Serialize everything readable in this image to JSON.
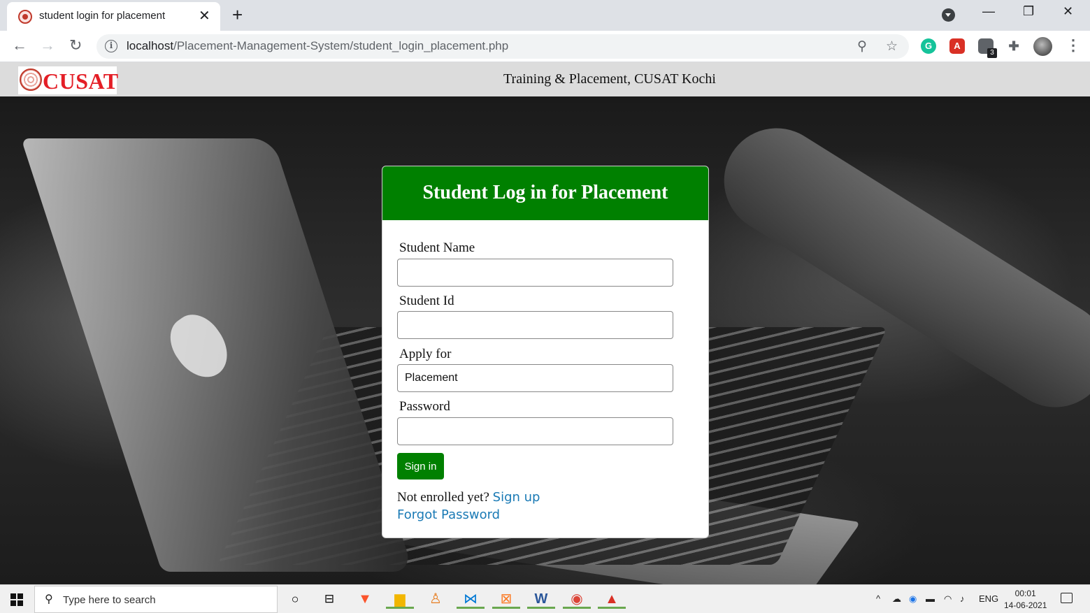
{
  "browser": {
    "tab_title": "student login for placement",
    "new_tab_label": "+",
    "url_host": "localhost",
    "url_path": "/Placement-Management-System/student_login_placement.php",
    "extensions": [
      {
        "name": "grammarly",
        "letter": "G",
        "color": "#15c39a"
      },
      {
        "name": "acrobat",
        "letter": "A",
        "color": "#d93025"
      },
      {
        "name": "extension-badge",
        "letter": "",
        "color": "#5f6368"
      }
    ],
    "extension_badge_count": "3"
  },
  "site": {
    "logo_text": "CUSAT",
    "header_title": "Training & Placement, CUSAT Kochi"
  },
  "login": {
    "title": "Student Log in for Placement",
    "fields": [
      {
        "label": "Student Name",
        "value": "",
        "type": "text"
      },
      {
        "label": "Student Id",
        "value": "",
        "type": "text"
      },
      {
        "label": "Apply for",
        "value": "Placement",
        "type": "text"
      },
      {
        "label": "Password",
        "value": "",
        "type": "password"
      }
    ],
    "signin_label": "Sign in",
    "not_enrolled_text": "Not enrolled yet?",
    "signup_label": "Sign up",
    "forgot_label": "Forgot Password",
    "accent_color": "#008000",
    "link_color": "#1a7ab5"
  },
  "taskbar": {
    "search_placeholder": "Type here to search",
    "language": "ENG",
    "time": "00:01",
    "date": "14-06-2021"
  }
}
